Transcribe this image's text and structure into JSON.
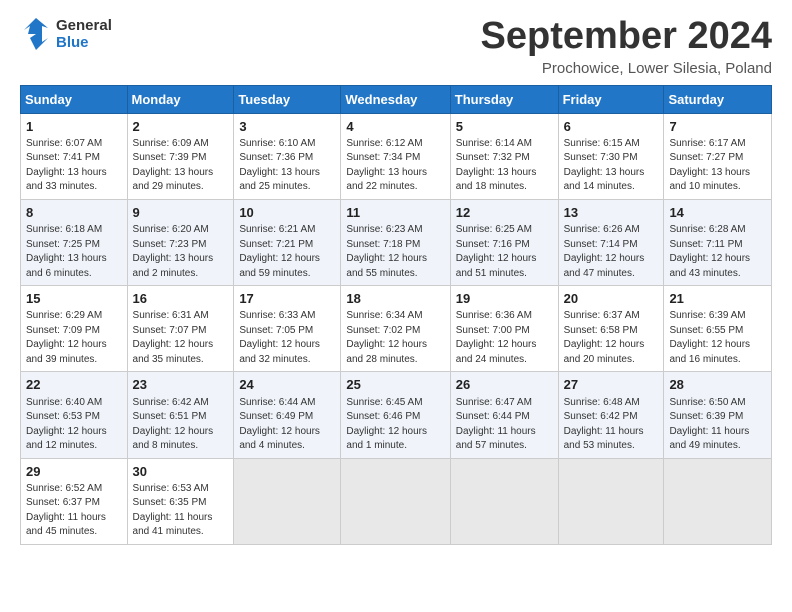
{
  "header": {
    "logo_line1": "General",
    "logo_line2": "Blue",
    "month_title": "September 2024",
    "location": "Prochowice, Lower Silesia, Poland"
  },
  "weekdays": [
    "Sunday",
    "Monday",
    "Tuesday",
    "Wednesday",
    "Thursday",
    "Friday",
    "Saturday"
  ],
  "weeks": [
    [
      {
        "day": "1",
        "info": "Sunrise: 6:07 AM\nSunset: 7:41 PM\nDaylight: 13 hours\nand 33 minutes."
      },
      {
        "day": "2",
        "info": "Sunrise: 6:09 AM\nSunset: 7:39 PM\nDaylight: 13 hours\nand 29 minutes."
      },
      {
        "day": "3",
        "info": "Sunrise: 6:10 AM\nSunset: 7:36 PM\nDaylight: 13 hours\nand 25 minutes."
      },
      {
        "day": "4",
        "info": "Sunrise: 6:12 AM\nSunset: 7:34 PM\nDaylight: 13 hours\nand 22 minutes."
      },
      {
        "day": "5",
        "info": "Sunrise: 6:14 AM\nSunset: 7:32 PM\nDaylight: 13 hours\nand 18 minutes."
      },
      {
        "day": "6",
        "info": "Sunrise: 6:15 AM\nSunset: 7:30 PM\nDaylight: 13 hours\nand 14 minutes."
      },
      {
        "day": "7",
        "info": "Sunrise: 6:17 AM\nSunset: 7:27 PM\nDaylight: 13 hours\nand 10 minutes."
      }
    ],
    [
      {
        "day": "8",
        "info": "Sunrise: 6:18 AM\nSunset: 7:25 PM\nDaylight: 13 hours\nand 6 minutes."
      },
      {
        "day": "9",
        "info": "Sunrise: 6:20 AM\nSunset: 7:23 PM\nDaylight: 13 hours\nand 2 minutes."
      },
      {
        "day": "10",
        "info": "Sunrise: 6:21 AM\nSunset: 7:21 PM\nDaylight: 12 hours\nand 59 minutes."
      },
      {
        "day": "11",
        "info": "Sunrise: 6:23 AM\nSunset: 7:18 PM\nDaylight: 12 hours\nand 55 minutes."
      },
      {
        "day": "12",
        "info": "Sunrise: 6:25 AM\nSunset: 7:16 PM\nDaylight: 12 hours\nand 51 minutes."
      },
      {
        "day": "13",
        "info": "Sunrise: 6:26 AM\nSunset: 7:14 PM\nDaylight: 12 hours\nand 47 minutes."
      },
      {
        "day": "14",
        "info": "Sunrise: 6:28 AM\nSunset: 7:11 PM\nDaylight: 12 hours\nand 43 minutes."
      }
    ],
    [
      {
        "day": "15",
        "info": "Sunrise: 6:29 AM\nSunset: 7:09 PM\nDaylight: 12 hours\nand 39 minutes."
      },
      {
        "day": "16",
        "info": "Sunrise: 6:31 AM\nSunset: 7:07 PM\nDaylight: 12 hours\nand 35 minutes."
      },
      {
        "day": "17",
        "info": "Sunrise: 6:33 AM\nSunset: 7:05 PM\nDaylight: 12 hours\nand 32 minutes."
      },
      {
        "day": "18",
        "info": "Sunrise: 6:34 AM\nSunset: 7:02 PM\nDaylight: 12 hours\nand 28 minutes."
      },
      {
        "day": "19",
        "info": "Sunrise: 6:36 AM\nSunset: 7:00 PM\nDaylight: 12 hours\nand 24 minutes."
      },
      {
        "day": "20",
        "info": "Sunrise: 6:37 AM\nSunset: 6:58 PM\nDaylight: 12 hours\nand 20 minutes."
      },
      {
        "day": "21",
        "info": "Sunrise: 6:39 AM\nSunset: 6:55 PM\nDaylight: 12 hours\nand 16 minutes."
      }
    ],
    [
      {
        "day": "22",
        "info": "Sunrise: 6:40 AM\nSunset: 6:53 PM\nDaylight: 12 hours\nand 12 minutes."
      },
      {
        "day": "23",
        "info": "Sunrise: 6:42 AM\nSunset: 6:51 PM\nDaylight: 12 hours\nand 8 minutes."
      },
      {
        "day": "24",
        "info": "Sunrise: 6:44 AM\nSunset: 6:49 PM\nDaylight: 12 hours\nand 4 minutes."
      },
      {
        "day": "25",
        "info": "Sunrise: 6:45 AM\nSunset: 6:46 PM\nDaylight: 12 hours\nand 1 minute."
      },
      {
        "day": "26",
        "info": "Sunrise: 6:47 AM\nSunset: 6:44 PM\nDaylight: 11 hours\nand 57 minutes."
      },
      {
        "day": "27",
        "info": "Sunrise: 6:48 AM\nSunset: 6:42 PM\nDaylight: 11 hours\nand 53 minutes."
      },
      {
        "day": "28",
        "info": "Sunrise: 6:50 AM\nSunset: 6:39 PM\nDaylight: 11 hours\nand 49 minutes."
      }
    ],
    [
      {
        "day": "29",
        "info": "Sunrise: 6:52 AM\nSunset: 6:37 PM\nDaylight: 11 hours\nand 45 minutes."
      },
      {
        "day": "30",
        "info": "Sunrise: 6:53 AM\nSunset: 6:35 PM\nDaylight: 11 hours\nand 41 minutes."
      },
      {
        "day": "",
        "info": ""
      },
      {
        "day": "",
        "info": ""
      },
      {
        "day": "",
        "info": ""
      },
      {
        "day": "",
        "info": ""
      },
      {
        "day": "",
        "info": ""
      }
    ]
  ]
}
